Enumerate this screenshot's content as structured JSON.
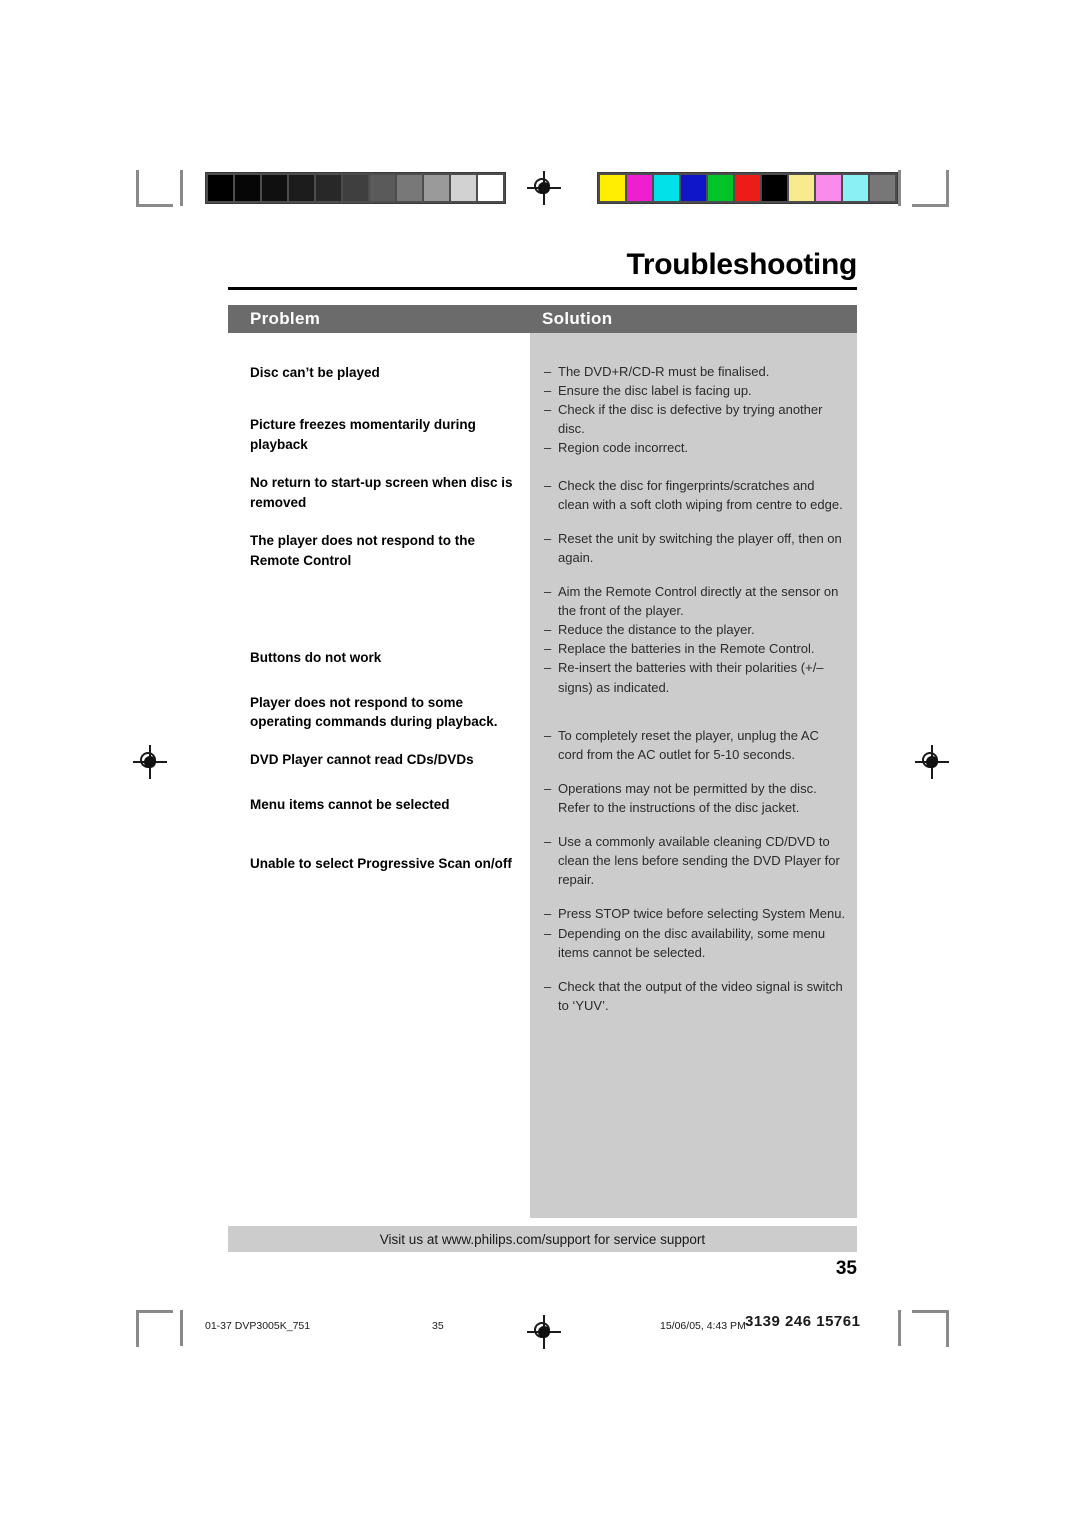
{
  "document": {
    "page_title": "Troubleshooting",
    "page_number": "35"
  },
  "table": {
    "header": {
      "problem": "Problem",
      "solution": "Solution"
    },
    "problems": [
      "Disc can’t be played",
      "Picture freezes momentarily during playback",
      "No return to start-up screen when disc is removed",
      "The player does not respond to the Remote Control",
      "Buttons do not work",
      "Player does not respond to some operating commands during playback.",
      "DVD Player cannot read CDs/DVDs",
      "Menu items cannot be selected",
      "Unable to select Progressive Scan on/off"
    ],
    "solution_groups": [
      [
        "The DVD+R/CD-R must be finalised.",
        "Ensure the disc label is facing up.",
        "Check if the disc is defective by trying another disc.",
        "Region code incorrect."
      ],
      [
        "Check the disc for fingerprints/scratches and clean with a soft cloth wiping from centre to edge."
      ],
      [
        "Reset the unit by switching the player off, then on again."
      ],
      [
        "Aim the Remote Control directly at the sensor on the front of the player.",
        "Reduce the distance to the player.",
        "Replace the batteries in the Remote Control.",
        "Re-insert the batteries with their polarities (+/– signs) as indicated."
      ],
      [
        "To completely reset the player, unplug the AC cord from the AC outlet for 5-10 seconds."
      ],
      [
        "Operations may not be permitted by the disc. Refer to the instructions of  the disc jacket."
      ],
      [
        "Use a commonly available cleaning CD/DVD to clean the lens before sending the DVD Player for repair."
      ],
      [
        "Press STOP twice before selecting System Menu.",
        "Depending on the disc availability, some menu items cannot be selected."
      ],
      [
        "Check that the output of the video signal is switch to ‘YUV’."
      ]
    ],
    "list_marker": "–"
  },
  "support_bar": {
    "text": "Visit us at www.philips.com/support for service support"
  },
  "print_slug": {
    "document_id": "01-37 DVP3005K_751",
    "page": "35",
    "timestamp": "15/06/05, 4:43 PM",
    "part_code": "3139 246 15761"
  },
  "calibration": {
    "grayscale_patches": [
      "#000000",
      "#060606",
      "#101010",
      "#1c1c1c",
      "#282828",
      "#3f3f3f",
      "#5a5a5a",
      "#787878",
      "#9a9a9a",
      "#d2d2d2",
      "#ffffff"
    ],
    "color_patches": [
      "#ffee00",
      "#ee1fd0",
      "#00e2e8",
      "#0f15c8",
      "#00c428",
      "#ec1c18",
      "#000000",
      "#f7eb8e",
      "#f98bec",
      "#8af0f4",
      "#777777"
    ]
  }
}
